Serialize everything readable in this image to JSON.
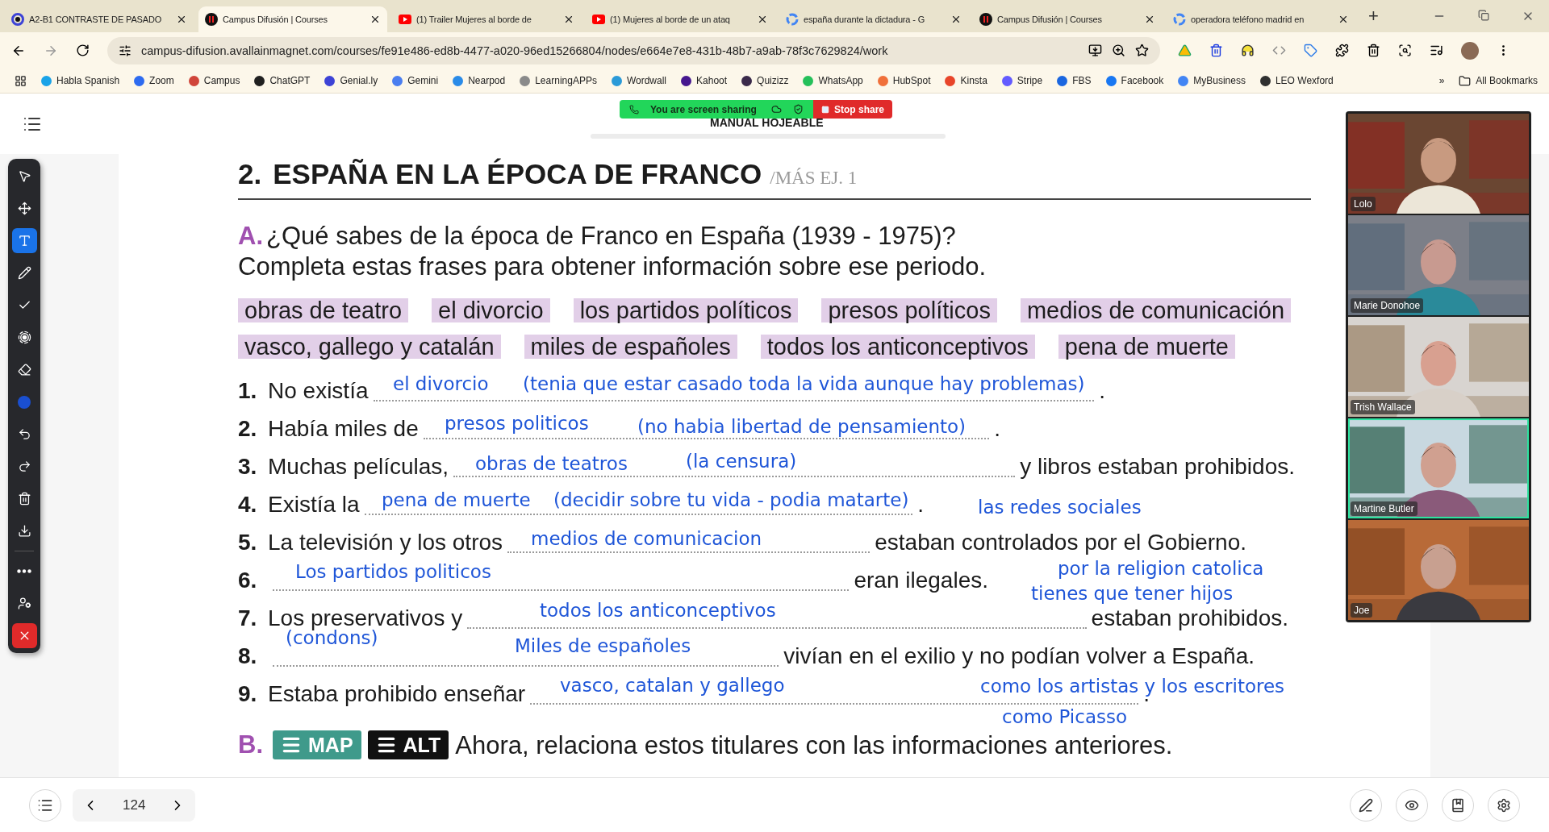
{
  "browser": {
    "tabs": [
      {
        "kind": "genially",
        "title": "A2-B1 CONTRASTE DE PASADO",
        "selected": false
      },
      {
        "kind": "campus",
        "title": "Campus Difusión | Courses",
        "selected": true
      },
      {
        "kind": "youtube",
        "title": "(1) Trailer Mujeres al borde de",
        "selected": false
      },
      {
        "kind": "youtube",
        "title": "(1) Mujeres al borde de un ataq",
        "selected": false
      },
      {
        "kind": "google",
        "title": "españa durante la dictadura - G",
        "selected": false
      },
      {
        "kind": "campus",
        "title": "Campus Difusión | Courses",
        "selected": false
      },
      {
        "kind": "google",
        "title": "operadora teléfono madrid en",
        "selected": false
      }
    ],
    "new_tab": "+",
    "url": "campus-difusion.avallainmagnet.com/courses/fe91e486-ed8b-4477-a020-96ed15266804/nodes/e664e7e8-431b-48b7-a9ab-78f3c7629824/work",
    "bookmarks": [
      {
        "label": "Habla Spanish",
        "color": "#1aa3e8"
      },
      {
        "label": "Zoom",
        "color": "#2d6bf0"
      },
      {
        "label": "Campus",
        "color": "#d0453a"
      },
      {
        "label": "ChatGPT",
        "color": "#202020"
      },
      {
        "label": "Genial.ly",
        "color": "#3d43d6"
      },
      {
        "label": "Gemini",
        "color": "#4a7ef0"
      },
      {
        "label": "Nearpod",
        "color": "#2a8be8"
      },
      {
        "label": "LearningAPPs",
        "color": "#8a8a8a"
      },
      {
        "label": "Wordwall",
        "color": "#2a9ad8"
      },
      {
        "label": "Kahoot",
        "color": "#46178f"
      },
      {
        "label": "Quizizz",
        "color": "#3a2a4a"
      },
      {
        "label": "WhatsApp",
        "color": "#25c05a"
      },
      {
        "label": "HubSpot",
        "color": "#f0703a"
      },
      {
        "label": "Kinsta",
        "color": "#e8452a"
      },
      {
        "label": "Stripe",
        "color": "#635bff"
      },
      {
        "label": "FBS",
        "color": "#1a66e0"
      },
      {
        "label": "Facebook",
        "color": "#1877f2"
      },
      {
        "label": "MyBusiness",
        "color": "#4285f4"
      },
      {
        "label": "LEO Wexford",
        "color": "#303030"
      }
    ],
    "more_bookmarks": "»",
    "all_bookmarks": "All Bookmarks"
  },
  "share_bar": {
    "status": "You are screen sharing",
    "stop": "Stop share"
  },
  "page_title": "MANUAL HOJEABLE",
  "tools": [
    {
      "kind": "select",
      "selected": false
    },
    {
      "kind": "move",
      "selected": false
    },
    {
      "kind": "text",
      "selected": true
    },
    {
      "kind": "pen",
      "selected": false
    },
    {
      "kind": "check",
      "selected": false
    },
    {
      "kind": "spotlight",
      "selected": false
    },
    {
      "kind": "eraser",
      "selected": false
    },
    {
      "kind": "color",
      "selected": false
    },
    {
      "kind": "undo",
      "selected": false
    },
    {
      "kind": "redo",
      "selected": false
    },
    {
      "kind": "delete",
      "selected": false
    },
    {
      "kind": "save",
      "selected": false
    },
    {
      "kind": "more",
      "selected": false
    },
    {
      "kind": "access",
      "selected": false
    },
    {
      "kind": "close",
      "selected": false
    }
  ],
  "worksheet": {
    "heading": {
      "number": "2.",
      "title": "ESPAÑA EN LA ÉPOCA DE FRANCO",
      "reference": "/MÁS EJ. 1"
    },
    "part_a": {
      "letter": "A.",
      "lines": [
        "¿Qué sabes de la época de Franco en España (1939 - 1975)?",
        "Completa estas frases para obtener información sobre ese periodo."
      ]
    },
    "word_bank": [
      {
        "words": [
          "obras de teatro",
          "el divorcio",
          "los partidos políticos",
          "presos políticos",
          "medios de comunicación"
        ]
      },
      {
        "words": [
          "vasco, gallego y catalán",
          "miles de españoles",
          "todos los anticonceptivos",
          "pena de muerte"
        ]
      }
    ],
    "sentences": [
      {
        "number": "1.",
        "before": "No existía",
        "after": "."
      },
      {
        "number": "2.",
        "before": "Había miles de",
        "after": "."
      },
      {
        "number": "3.",
        "before": "Muchas películas,",
        "after": "y libros estaban prohibidos."
      },
      {
        "number": "4.",
        "before": "Existía la",
        "after": "."
      },
      {
        "number": "5.",
        "before": "La televisión y los otros",
        "after": "estaban controlados por el Gobierno."
      },
      {
        "number": "6.",
        "after": "eran ilegales."
      },
      {
        "number": "7.",
        "before": "Los preservativos y",
        "after": "estaban prohibidos."
      },
      {
        "number": "8.",
        "after": "vivían en el exilio y no podían volver a España."
      },
      {
        "number": "9.",
        "before": "Estaba prohibido enseñar",
        "after": "."
      }
    ],
    "part_b": {
      "letter": "B.",
      "buttons": [
        "MAP",
        "ALT"
      ],
      "text": "Ahora, relaciona estos titulares con las informaciones anteriores."
    },
    "annotations": [
      "el divorcio",
      "(tenia que estar casado toda la vida aunque hay problemas)",
      "presos politicos",
      "(no habia libertad de pensamiento)",
      "obras de teatros",
      "(la censura)",
      "pena de muerte",
      "(decidir sobre tu vida - podia matarte)",
      "las redes sociales",
      "medios de comunicacion",
      "Los partidos politicos",
      "por la religion catolica",
      "tienes que tener hijos",
      "todos los anticonceptivos",
      "(condons)",
      "Miles de españoles",
      "vasco, catalan y gallego",
      "como los artistas y los escritores",
      "como Picasso"
    ]
  },
  "participants": [
    {
      "name": "Lolo",
      "speaking": false
    },
    {
      "name": "Marie Donohoe",
      "speaking": false
    },
    {
      "name": "Trish Wallace",
      "speaking": false
    },
    {
      "name": "Martine Butler",
      "speaking": true
    },
    {
      "name": "Joe",
      "speaking": false
    }
  ],
  "pager": {
    "page": "124"
  }
}
